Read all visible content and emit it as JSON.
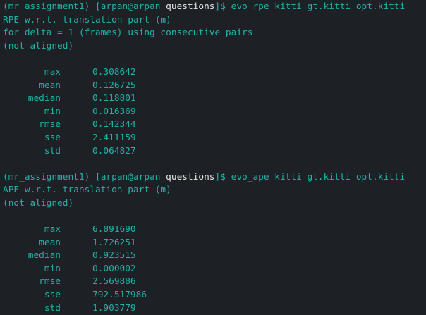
{
  "blocks": [
    {
      "prompt": {
        "env": "(mr_assignment1)",
        "userhost": "[arpan@arpan",
        "dir": "questions",
        "suffix": "]$",
        "command": " evo_rpe kitti gt.kitti opt.kitti"
      },
      "header_lines": [
        "RPE w.r.t. translation part (m)",
        "for delta = 1 (frames) using consecutive pairs",
        "(not aligned)"
      ],
      "stats": [
        {
          "name": "max",
          "value": "0.308642"
        },
        {
          "name": "mean",
          "value": "0.126725"
        },
        {
          "name": "median",
          "value": "0.118801"
        },
        {
          "name": "min",
          "value": "0.016369"
        },
        {
          "name": "rmse",
          "value": "0.142344"
        },
        {
          "name": "sse",
          "value": "2.411159"
        },
        {
          "name": "std",
          "value": "0.064827"
        }
      ]
    },
    {
      "prompt": {
        "env": "(mr_assignment1)",
        "userhost": "[arpan@arpan",
        "dir": "questions",
        "suffix": "]$",
        "command": " evo_ape kitti gt.kitti opt.kitti"
      },
      "header_lines": [
        "APE w.r.t. translation part (m)",
        "(not aligned)"
      ],
      "stats": [
        {
          "name": "max",
          "value": "6.891690"
        },
        {
          "name": "mean",
          "value": "1.726251"
        },
        {
          "name": "median",
          "value": "0.923515"
        },
        {
          "name": "min",
          "value": "0.000002"
        },
        {
          "name": "rmse",
          "value": "2.569886"
        },
        {
          "name": "sse",
          "value": "792.517986"
        },
        {
          "name": "std",
          "value": "1.903779"
        }
      ]
    }
  ],
  "colors": {
    "background": "#1d2126",
    "text": "#23b1a4",
    "directory": "#e6e6e6"
  }
}
